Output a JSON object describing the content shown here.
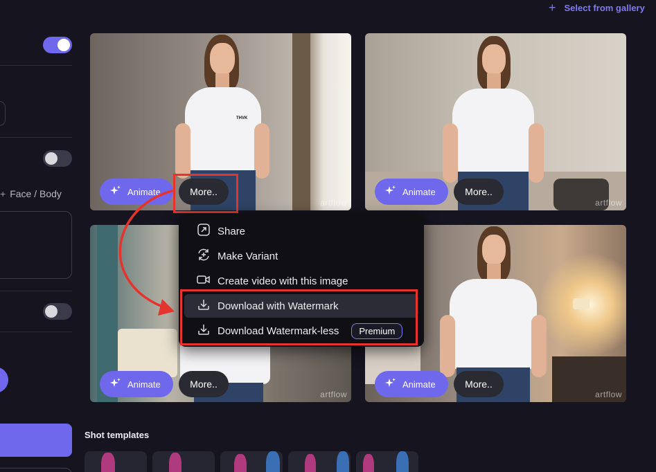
{
  "header": {
    "select_gallery_label": "Select from gallery"
  },
  "left_panel": {
    "face_body_label": "Face / Body",
    "face_body_prefix": "+"
  },
  "cards": [
    {
      "animate_label": "Animate",
      "more_label": "More..",
      "watermark": "artflow"
    },
    {
      "animate_label": "Animate",
      "more_label": "More..",
      "watermark": "artflow"
    },
    {
      "animate_label": "Animate",
      "more_label": "More..",
      "watermark": "artflow"
    },
    {
      "animate_label": "Animate",
      "more_label": "More..",
      "watermark": "artflow"
    }
  ],
  "shirt_text": "THVK",
  "menu": {
    "items": [
      {
        "label": "Share",
        "icon": "share-icon"
      },
      {
        "label": "Make Variant",
        "icon": "variant-icon"
      },
      {
        "label": "Create video with this image",
        "icon": "video-icon"
      },
      {
        "label": "Download with Watermark",
        "icon": "download-icon"
      },
      {
        "label": "Download Watermark-less",
        "icon": "download-icon",
        "badge": "Premium"
      }
    ]
  },
  "shot_templates": {
    "title": "Shot templates"
  },
  "colors": {
    "accent": "#7068ec",
    "highlight": "#e5342e",
    "background": "#15141f",
    "link": "#7f7bf0"
  }
}
